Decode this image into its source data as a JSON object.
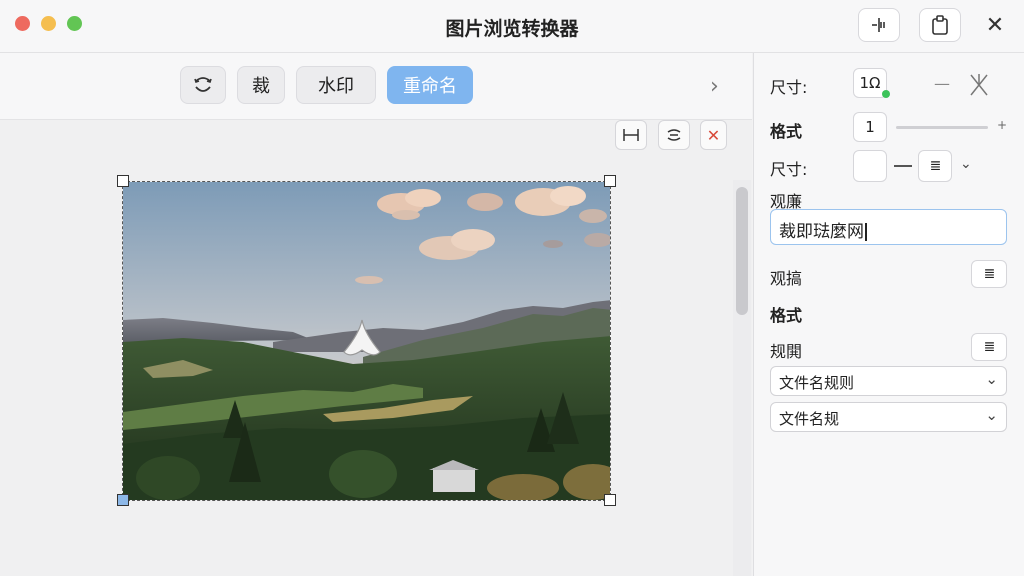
{
  "window": {
    "title": "图片浏览转换器",
    "buttons": [
      "split-icon",
      "clipboard-icon",
      "close-icon"
    ]
  },
  "toolbar": {
    "rotate_icon": "rotate-icon",
    "crop_label": "裁",
    "watermark_label": "水印",
    "rename_label": "重命名",
    "active": "重命名"
  },
  "canvas_tools": [
    "fit-width-icon",
    "flip-icon",
    "close-icon"
  ],
  "sidebar": {
    "size_label_1": "尺寸:",
    "size_value_1": "1Ω",
    "format_label_1": "格式",
    "format_value": "1",
    "size_label_2": "尺寸:",
    "field_label_1": "观廉",
    "text_value": "裁即琺麼网",
    "field_label_2": "观搞",
    "format_label_2": "格式",
    "field_label_3": "规閧",
    "select_1": "文件名规则",
    "select_2": "文件名规"
  },
  "colors": {
    "accent": "#7fb5ef",
    "close_red": "#d84a3a",
    "status_green": "#3cc35a"
  }
}
